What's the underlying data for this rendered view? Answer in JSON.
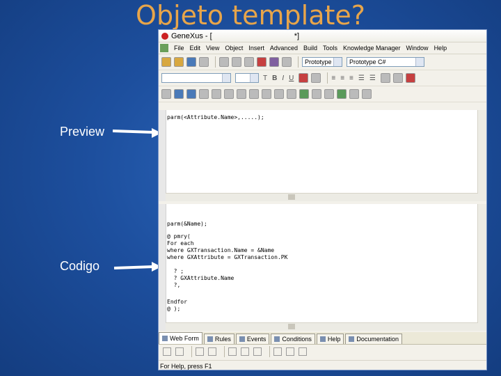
{
  "slide": {
    "title": "Objeto template?",
    "preview_label": "Preview",
    "code_label": "Codigo"
  },
  "window": {
    "title_left": "GeneXus - [",
    "title_right": "*]",
    "menu": [
      "File",
      "Edit",
      "View",
      "Object",
      "Insert",
      "Advanced",
      "Build",
      "Tools",
      "Knowledge Manager",
      "Window",
      "Help"
    ],
    "combo_prototype": "Prototype",
    "combo_target": "Prototype C#"
  },
  "preview_code": "parm(<Attribute.Name>,.....);",
  "source_code": [
    "parm(&Name);",
    "",
    "@ pmry(",
    "For each",
    "where GXTransaction.Name = &Name",
    "where GXAttribute = GXTransaction.PK",
    "",
    "  ? ;",
    "  ? GXAttribute.Name",
    "  ?,",
    "",
    "Endfor",
    "@ );"
  ],
  "tabs": [
    "Web Form",
    "Rules",
    "Events",
    "Conditions",
    "Help",
    "Documentation"
  ],
  "status": "For Help, press F1",
  "colors": {
    "title": "#e8a54a",
    "background": "#1d4f9e"
  }
}
